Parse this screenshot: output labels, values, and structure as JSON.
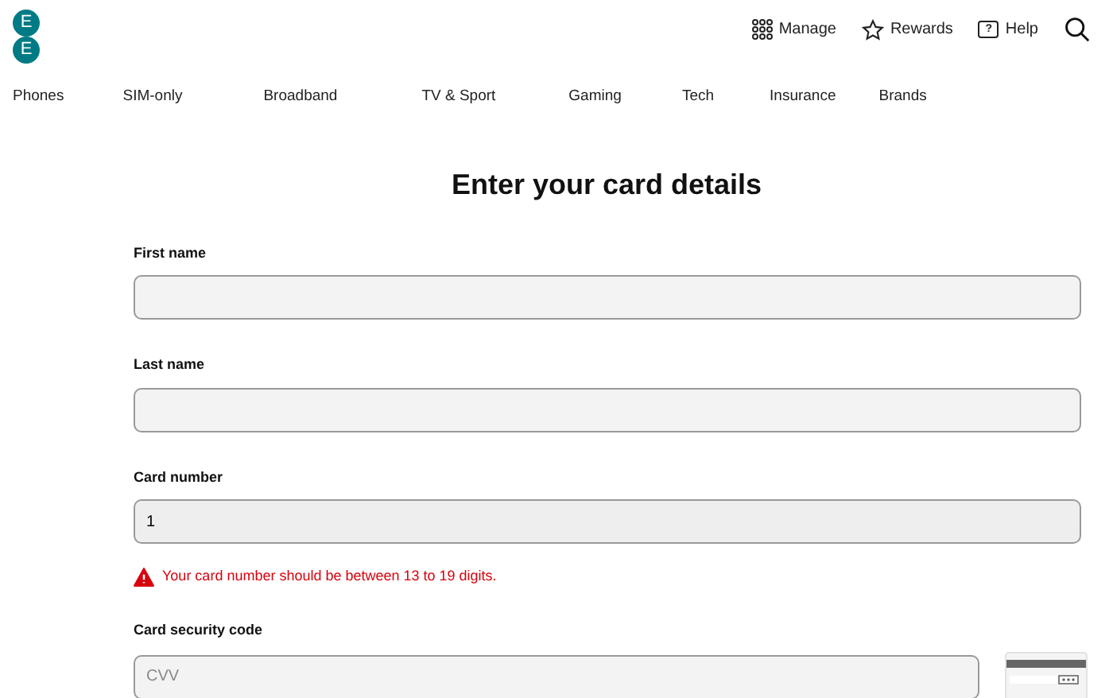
{
  "logo": {
    "letters": [
      "E",
      "E"
    ]
  },
  "header_links": [
    {
      "kind": "manage",
      "label": "Manage"
    },
    {
      "kind": "rewards",
      "label": "Rewards"
    },
    {
      "kind": "help",
      "label": "Help",
      "icon_text": "?"
    }
  ],
  "nav": [
    "Phones",
    "SIM-only",
    "Broadband",
    "TV & Sport",
    "Gaming",
    "Tech",
    "Insurance",
    "Brands"
  ],
  "title": "Enter your card details",
  "fields": [
    {
      "label": "First name"
    },
    {
      "label": "Last name"
    },
    {
      "label": "Card number",
      "value": "1",
      "error": "Your card number should be between 13 to 19 digits."
    },
    {
      "label": "Card security code",
      "placeholder": "CVV",
      "card_hint": true
    }
  ]
}
